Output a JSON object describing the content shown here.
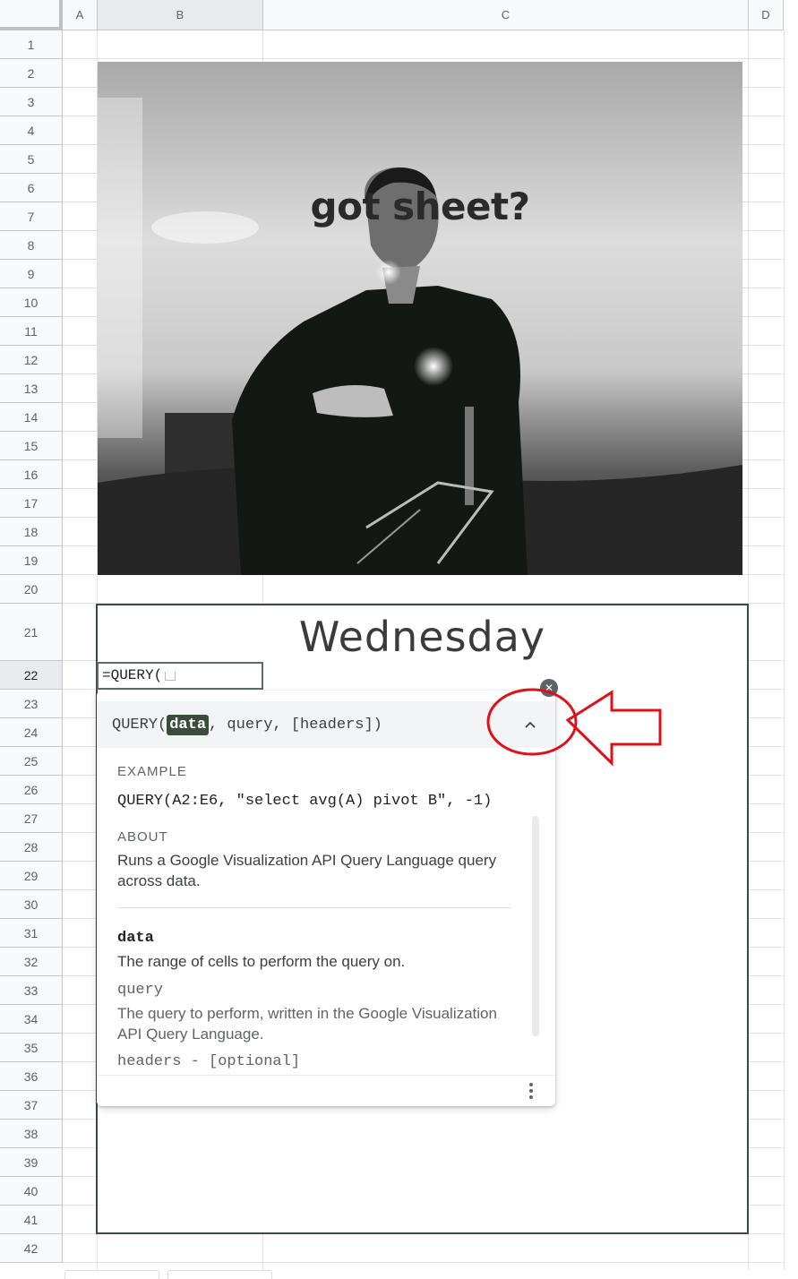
{
  "columns": [
    {
      "label": "A"
    },
    {
      "label": "B"
    },
    {
      "label": "C"
    },
    {
      "label": "D"
    }
  ],
  "rows": [
    "1",
    "2",
    "3",
    "4",
    "5",
    "6",
    "7",
    "8",
    "9",
    "10",
    "11",
    "12",
    "13",
    "14",
    "15",
    "16",
    "17",
    "18",
    "19",
    "20",
    "21",
    "22",
    "23",
    "24",
    "25",
    "26",
    "27",
    "28",
    "29",
    "30",
    "31",
    "32",
    "33",
    "34",
    "35",
    "36",
    "37",
    "38",
    "39",
    "40",
    "41",
    "42"
  ],
  "active_row": "22",
  "active_column": "B",
  "image": {
    "caption": "got sheet?"
  },
  "merged_cell": {
    "title": "Wednesday"
  },
  "cell_editor": {
    "value": "=QUERY("
  },
  "formula_help": {
    "signature": {
      "name": "QUERY(",
      "active_arg": "data",
      "rest": ", query, [headers])"
    },
    "example_label": "EXAMPLE",
    "example": "QUERY(A2:E6, \"select avg(A) pivot B\", -1)",
    "about_label": "ABOUT",
    "about": "Runs a Google Visualization API Query Language query across data.",
    "params": [
      {
        "name": "data",
        "description": "The range of cells to perform the query on."
      },
      {
        "name": "query",
        "description": "The query to perform, written in the Google Visualization API Query Language."
      },
      {
        "name": "headers - [optional]",
        "description": ""
      }
    ],
    "collapse_icon": "chevron-up-icon",
    "close_icon": "close-icon",
    "more_icon": "more-vert-icon"
  },
  "annotation": {
    "color": "#e0101a"
  }
}
